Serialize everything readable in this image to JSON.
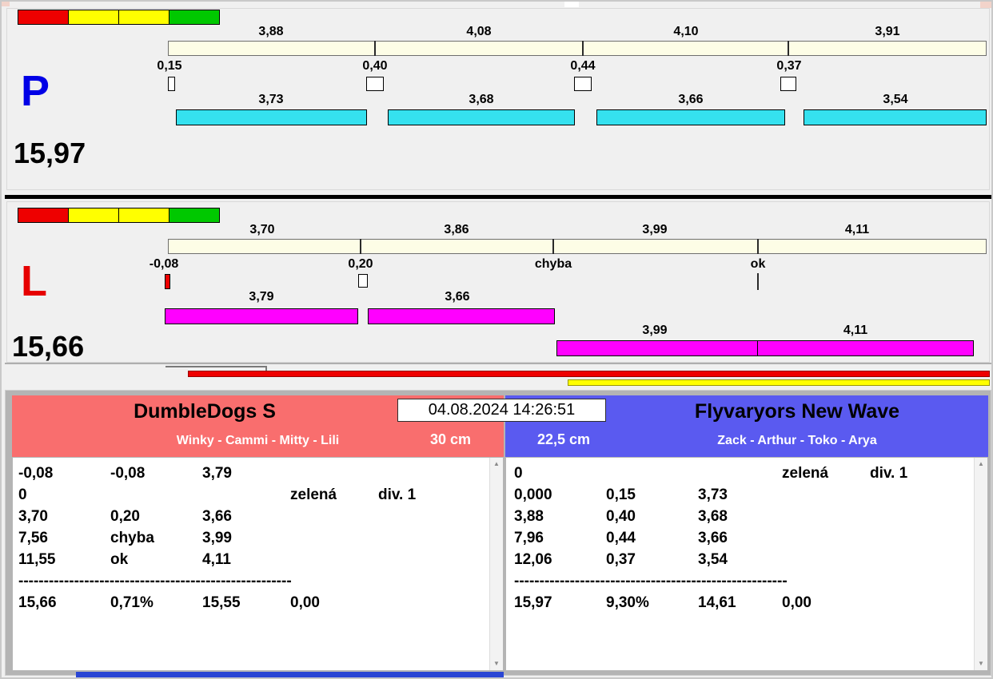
{
  "colors": {
    "cyan": "#35e1ef",
    "magenta": "#ff00ff",
    "red": "#ee0000",
    "yellow": "#ffff00",
    "green": "#00c800",
    "cream": "#fdfde6",
    "hdr-red": "#f96e6e",
    "hdr-blue": "#5a5af0",
    "big-p": "#0000e6",
    "big-l": "#e60000",
    "strip-blue": "#2a46d4"
  },
  "lane_p": {
    "letter": "P",
    "total": "15,97",
    "splits": [
      "3,88",
      "4,08",
      "4,10",
      "3,91"
    ],
    "starts": [
      "0,15",
      "0,40",
      "0,44",
      "0,37"
    ],
    "dog_times": [
      "3,73",
      "3,68",
      "3,66",
      "3,54"
    ]
  },
  "lane_l": {
    "letter": "L",
    "total": "15,66",
    "splits": [
      "3,70",
      "3,86",
      "3,99",
      "4,11"
    ],
    "starts": [
      "-0,08",
      "0,20",
      "chyba",
      "ok"
    ],
    "dog_times_row1": [
      "3,79",
      "3,66"
    ],
    "dog_times_row2": [
      "3,99",
      "4,11"
    ]
  },
  "timestamp": "04.08.2024 14:26:51",
  "teams": {
    "left": {
      "name": "DumbleDogs S",
      "members": "Winky - Cammi - Mitty - Lili",
      "jump_height": "30 cm",
      "rows": [
        [
          "-0,08",
          "-0,08",
          "3,79",
          "",
          ""
        ],
        [
          "0",
          "",
          "",
          "zelená",
          "div. 1"
        ],
        [
          "3,70",
          "0,20",
          "3,66",
          "",
          ""
        ],
        [
          "7,56",
          "chyba",
          "3,99",
          "",
          ""
        ],
        [
          "11,55",
          "ok",
          "4,11",
          "",
          ""
        ]
      ],
      "divider": "------------------------------------------------------",
      "summary": [
        "15,66",
        "0,71%",
        "15,55",
        "0,00"
      ]
    },
    "right": {
      "name": "Flyvaryors New Wave",
      "members": "Zack - Arthur - Toko - Arya",
      "jump_height": "22,5 cm",
      "rows": [
        [
          "0",
          "",
          "",
          "zelená",
          "div. 1"
        ],
        [
          "0,000",
          "0,15",
          "3,73",
          "",
          ""
        ],
        [
          "3,88",
          "0,40",
          "3,68",
          "",
          ""
        ],
        [
          "7,96",
          "0,44",
          "3,66",
          "",
          ""
        ],
        [
          "12,06",
          "0,37",
          "3,54",
          "",
          ""
        ]
      ],
      "divider": "------------------------------------------------------",
      "summary": [
        "15,97",
        "9,30%",
        "14,61",
        "0,00"
      ]
    }
  }
}
